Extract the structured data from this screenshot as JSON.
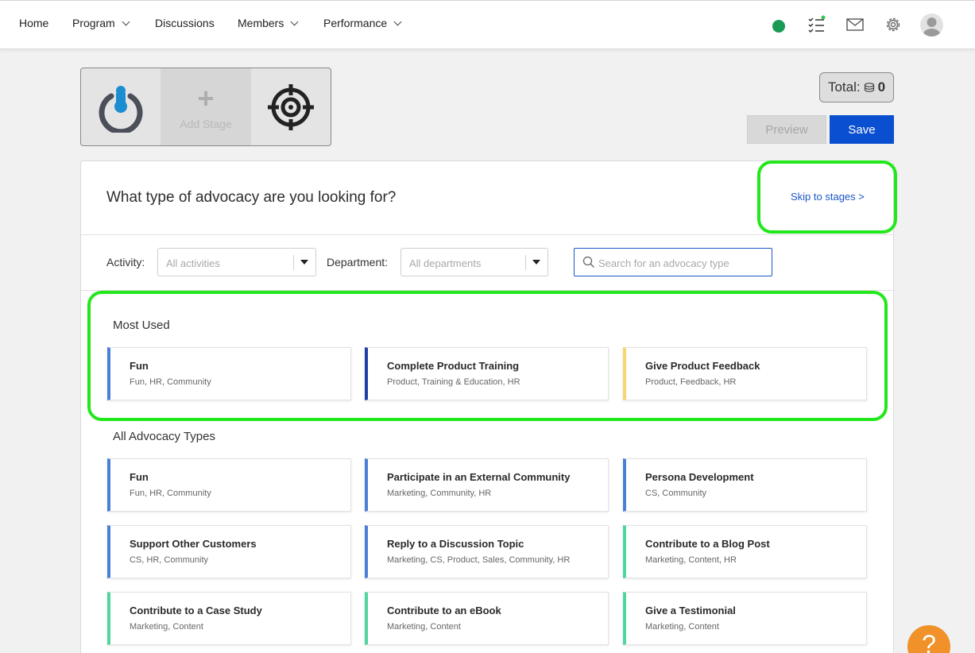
{
  "nav": {
    "items": [
      {
        "label": "Home",
        "dropdown": false
      },
      {
        "label": "Program",
        "dropdown": true
      },
      {
        "label": "Discussions",
        "dropdown": false
      },
      {
        "label": "Members",
        "dropdown": true
      },
      {
        "label": "Performance",
        "dropdown": true
      }
    ],
    "icons": [
      "status-online",
      "checklist-icon",
      "mail-icon",
      "gear-icon",
      "avatar"
    ],
    "status_color": "#1a9a55"
  },
  "stages": {
    "add_label": "Add Stage",
    "add_symbol": "+"
  },
  "total": {
    "label": "Total:",
    "value": "0"
  },
  "actions": {
    "preview_label": "Preview",
    "save_label": "Save"
  },
  "panel": {
    "title": "What type of advocacy are you looking for?",
    "skip_label": "Skip to stages >"
  },
  "filters": {
    "activity_label": "Activity:",
    "activity_value": "All activities",
    "department_label": "Department:",
    "department_value": "All departments",
    "search_placeholder": "Search for an advocacy type"
  },
  "most_used": {
    "title": "Most Used",
    "cards": [
      {
        "title": "Fun",
        "tags": "Fun, HR, Community",
        "accent": "#4a7fd8"
      },
      {
        "title": "Complete Product Training",
        "tags": "Product, Training & Education, HR",
        "accent": "#1f3fa8"
      },
      {
        "title": "Give Product Feedback",
        "tags": "Product, Feedback, HR",
        "accent": "#f5d76e"
      }
    ]
  },
  "all_types": {
    "title": "All Advocacy Types",
    "cards": [
      {
        "title": "Fun",
        "tags": "Fun, HR, Community",
        "accent": "#4a7fd8"
      },
      {
        "title": "Participate in an External Community",
        "tags": "Marketing, Community, HR",
        "accent": "#4a7fd8"
      },
      {
        "title": "Persona Development",
        "tags": "CS, Community",
        "accent": "#4a7fd8"
      },
      {
        "title": "Support Other Customers",
        "tags": "CS, HR, Community",
        "accent": "#4a7fd8"
      },
      {
        "title": "Reply to a Discussion Topic",
        "tags": "Marketing, CS, Product, Sales, Community, HR",
        "accent": "#4a7fd8"
      },
      {
        "title": "Contribute to a Blog Post",
        "tags": "Marketing, Content, HR",
        "accent": "#4fd69c"
      },
      {
        "title": "Contribute to a Case Study",
        "tags": "Marketing, Content",
        "accent": "#4fd69c"
      },
      {
        "title": "Contribute to an eBook",
        "tags": "Marketing, Content",
        "accent": "#4fd69c"
      },
      {
        "title": "Give a Testimonial",
        "tags": "Marketing, Content",
        "accent": "#4fd69c"
      }
    ]
  },
  "help": {
    "label": "?"
  }
}
